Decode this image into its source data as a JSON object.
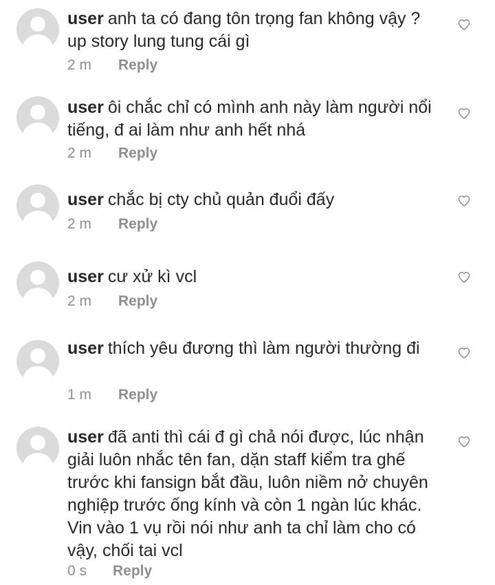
{
  "comments": [
    {
      "username": "user",
      "text": "anh ta có đang tôn trọng fan không vậy ? up story lung tung cái gì",
      "time": "2 m",
      "reply": "Reply"
    },
    {
      "username": "user",
      "text": "ôi chắc chỉ có mình anh này làm người nổi tiếng, đ ai làm như anh hết nhá",
      "time": "2 m",
      "reply": "Reply"
    },
    {
      "username": "user",
      "text": "chắc bị cty chủ quản đuổi đấy",
      "time": "2 m",
      "reply": "Reply"
    },
    {
      "username": "user",
      "text": "cư xử kì vcl",
      "time": "2 m",
      "reply": "Reply"
    },
    {
      "username": "user",
      "text": "thích yêu đương thì làm người thường đi",
      "time": "1 m",
      "reply": "Reply"
    },
    {
      "username": "user",
      "text": "đã anti thì cái đ gì chả nói được, lúc nhận giải luôn nhắc tên fan, dặn staff kiểm tra ghế trước khi fansign bắt đầu, luôn niềm nở chuyên nghiệp trước ống kính và còn 1 ngàn lúc khác. Vin vào 1 vụ rồi nói như anh ta chỉ làm cho có vậy, chối tai vcl",
      "time": "0 s",
      "reply": "Reply"
    }
  ],
  "icons": {
    "avatar": "default-avatar-icon",
    "like": "heart-outline-icon"
  }
}
